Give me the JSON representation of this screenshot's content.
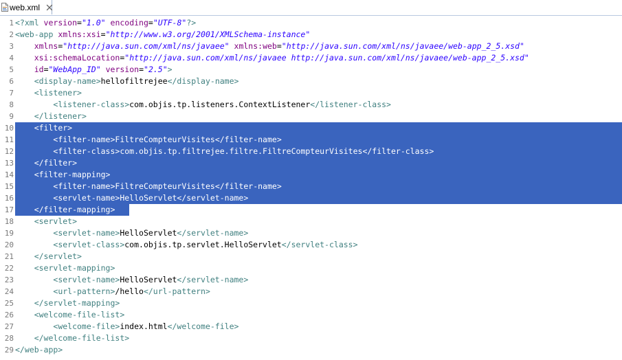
{
  "tab": {
    "label": "web.xml",
    "file_icon": "xml-file-icon",
    "close_icon": "close-icon"
  },
  "colors": {
    "tag": "#3f7f7f",
    "attribute": "#7f007f",
    "value": "#2a00ff",
    "text": "#000000",
    "selection": "#3a64be"
  },
  "lines": [
    {
      "n": "1",
      "indent": 0,
      "sel": "",
      "parts": [
        [
          "pi",
          "<?xml "
        ],
        [
          "attr",
          "version"
        ],
        [
          "txt",
          "="
        ],
        [
          "val",
          "\"1.0\""
        ],
        [
          "txt",
          " "
        ],
        [
          "attr",
          "encoding"
        ],
        [
          "txt",
          "="
        ],
        [
          "val",
          "\"UTF-8\""
        ],
        [
          "pi",
          "?>"
        ]
      ]
    },
    {
      "n": "2",
      "indent": 0,
      "sel": "",
      "parts": [
        [
          "tag",
          "<web-app "
        ],
        [
          "attr",
          "xmlns:xsi"
        ],
        [
          "txt",
          "="
        ],
        [
          "val",
          "\"http://www.w3.org/2001/XMLSchema-instance\""
        ]
      ]
    },
    {
      "n": "3",
      "indent": 4,
      "sel": "",
      "parts": [
        [
          "attr",
          "xmlns"
        ],
        [
          "txt",
          "="
        ],
        [
          "val",
          "\"http://java.sun.com/xml/ns/javaee\""
        ],
        [
          "txt",
          " "
        ],
        [
          "attr",
          "xmlns:web"
        ],
        [
          "txt",
          "="
        ],
        [
          "val",
          "\"http://java.sun.com/xml/ns/javaee/web-app_2_5.xsd\""
        ]
      ]
    },
    {
      "n": "4",
      "indent": 4,
      "sel": "",
      "parts": [
        [
          "attr",
          "xsi:schemaLocation"
        ],
        [
          "txt",
          "="
        ],
        [
          "val",
          "\"http://java.sun.com/xml/ns/javaee http://java.sun.com/xml/ns/javaee/web-app_2_5.xsd\""
        ]
      ]
    },
    {
      "n": "5",
      "indent": 4,
      "sel": "",
      "parts": [
        [
          "attr",
          "id"
        ],
        [
          "txt",
          "="
        ],
        [
          "val",
          "\"WebApp_ID\""
        ],
        [
          "txt",
          " "
        ],
        [
          "attr",
          "version"
        ],
        [
          "txt",
          "="
        ],
        [
          "val",
          "\"2.5\""
        ],
        [
          "tag",
          ">"
        ]
      ]
    },
    {
      "n": "6",
      "indent": 4,
      "sel": "",
      "parts": [
        [
          "tag",
          "<display-name>"
        ],
        [
          "txt",
          "hellofiltrejee"
        ],
        [
          "tag",
          "</display-name>"
        ]
      ]
    },
    {
      "n": "7",
      "indent": 4,
      "sel": "",
      "parts": [
        [
          "tag",
          "<listener>"
        ]
      ]
    },
    {
      "n": "8",
      "indent": 8,
      "sel": "",
      "parts": [
        [
          "tag",
          "<listener-class>"
        ],
        [
          "txt",
          "com.objis.tp.listeners.ContextListener"
        ],
        [
          "tag",
          "</listener-class>"
        ]
      ]
    },
    {
      "n": "9",
      "indent": 4,
      "sel": "",
      "parts": [
        [
          "tag",
          "</listener>"
        ]
      ]
    },
    {
      "n": "10",
      "indent": 4,
      "sel": "full",
      "parts": [
        [
          "tag",
          "<filter>"
        ]
      ]
    },
    {
      "n": "11",
      "indent": 8,
      "sel": "full",
      "parts": [
        [
          "tag",
          "<filter-name>"
        ],
        [
          "txt",
          "FiltreCompteurVisites"
        ],
        [
          "tag",
          "</filter-name>"
        ]
      ]
    },
    {
      "n": "12",
      "indent": 8,
      "sel": "full",
      "parts": [
        [
          "tag",
          "<filter-class>"
        ],
        [
          "txt",
          "com.objis.tp.filtrejee.filtre.FiltreCompteurVisites"
        ],
        [
          "tag",
          "</filter-class>"
        ]
      ]
    },
    {
      "n": "13",
      "indent": 4,
      "sel": "full",
      "parts": [
        [
          "tag",
          "</filter>"
        ]
      ]
    },
    {
      "n": "14",
      "indent": 4,
      "sel": "full",
      "parts": [
        [
          "tag",
          "<filter-mapping>"
        ]
      ]
    },
    {
      "n": "15",
      "indent": 8,
      "sel": "full",
      "parts": [
        [
          "tag",
          "<filter-name>"
        ],
        [
          "txt",
          "FiltreCompteurVisites"
        ],
        [
          "tag",
          "</filter-name>"
        ]
      ]
    },
    {
      "n": "16",
      "indent": 8,
      "sel": "full",
      "parts": [
        [
          "tag",
          "<servlet-name>"
        ],
        [
          "txt",
          "HelloServlet"
        ],
        [
          "tag",
          "</servlet-name>"
        ]
      ]
    },
    {
      "n": "17",
      "indent": 4,
      "sel": "partial",
      "parts": [
        [
          "tag",
          "</filter-mapping>"
        ]
      ]
    },
    {
      "n": "18",
      "indent": 4,
      "sel": "",
      "parts": [
        [
          "tag",
          "<servlet>"
        ]
      ]
    },
    {
      "n": "19",
      "indent": 8,
      "sel": "",
      "parts": [
        [
          "tag",
          "<servlet-name>"
        ],
        [
          "txt",
          "HelloServlet"
        ],
        [
          "tag",
          "</servlet-name>"
        ]
      ]
    },
    {
      "n": "20",
      "indent": 8,
      "sel": "",
      "parts": [
        [
          "tag",
          "<servlet-class>"
        ],
        [
          "txt",
          "com.objis.tp.servlet.HelloServlet"
        ],
        [
          "tag",
          "</servlet-class>"
        ]
      ]
    },
    {
      "n": "21",
      "indent": 4,
      "sel": "",
      "parts": [
        [
          "tag",
          "</servlet>"
        ]
      ]
    },
    {
      "n": "22",
      "indent": 4,
      "sel": "",
      "parts": [
        [
          "tag",
          "<servlet-mapping>"
        ]
      ]
    },
    {
      "n": "23",
      "indent": 8,
      "sel": "",
      "parts": [
        [
          "tag",
          "<servlet-name>"
        ],
        [
          "txt",
          "HelloServlet"
        ],
        [
          "tag",
          "</servlet-name>"
        ]
      ]
    },
    {
      "n": "24",
      "indent": 8,
      "sel": "",
      "parts": [
        [
          "tag",
          "<url-pattern>"
        ],
        [
          "txt",
          "/hello"
        ],
        [
          "tag",
          "</url-pattern>"
        ]
      ]
    },
    {
      "n": "25",
      "indent": 4,
      "sel": "",
      "parts": [
        [
          "tag",
          "</servlet-mapping>"
        ]
      ]
    },
    {
      "n": "26",
      "indent": 4,
      "sel": "",
      "parts": [
        [
          "tag",
          "<welcome-file-list>"
        ]
      ]
    },
    {
      "n": "27",
      "indent": 8,
      "sel": "",
      "parts": [
        [
          "tag",
          "<welcome-file>"
        ],
        [
          "txt",
          "index.html"
        ],
        [
          "tag",
          "</welcome-file>"
        ]
      ]
    },
    {
      "n": "28",
      "indent": 4,
      "sel": "",
      "parts": [
        [
          "tag",
          "</welcome-file-list>"
        ]
      ]
    },
    {
      "n": "29",
      "indent": 0,
      "sel": "",
      "parts": [
        [
          "tag",
          "</web-app>"
        ]
      ]
    }
  ]
}
